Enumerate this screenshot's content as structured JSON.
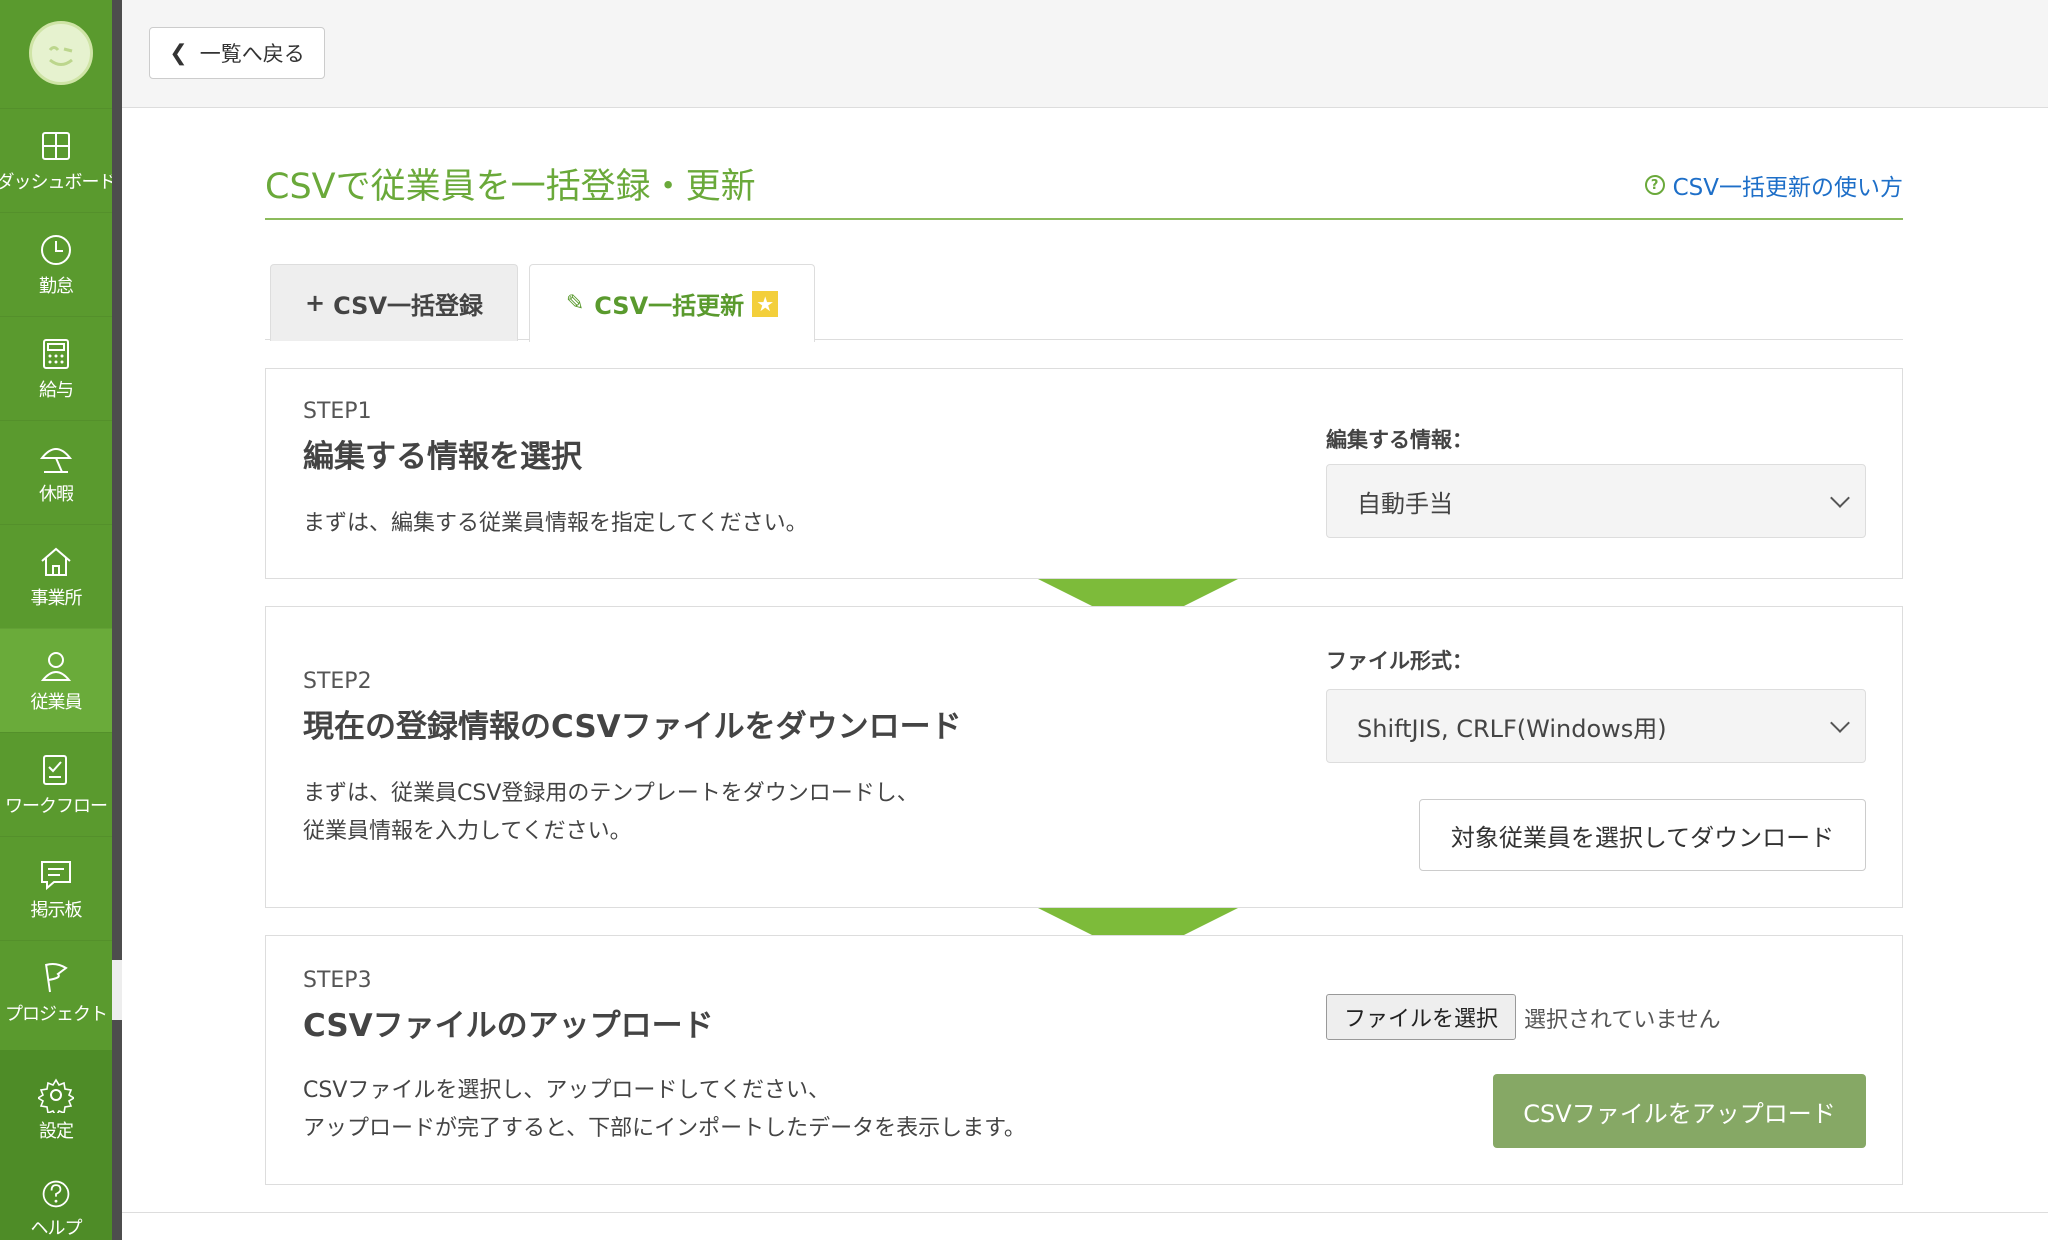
{
  "sidebar": {
    "items": [
      {
        "label": "ダッシュボード",
        "icon": "dashboard-icon"
      },
      {
        "label": "勤怠",
        "icon": "clock-icon"
      },
      {
        "label": "給与",
        "icon": "calculator-icon"
      },
      {
        "label": "休暇",
        "icon": "beach-umbrella-icon"
      },
      {
        "label": "事業所",
        "icon": "house-icon"
      },
      {
        "label": "従業員",
        "icon": "person-icon",
        "active": true
      },
      {
        "label": "ワークフロー",
        "icon": "checklist-icon"
      },
      {
        "label": "掲示板",
        "icon": "message-icon"
      },
      {
        "label": "プロジェクト",
        "icon": "flag-icon"
      },
      {
        "label": "設定",
        "icon": "gear-icon"
      },
      {
        "label": "ヘルプ",
        "icon": "help-icon"
      }
    ]
  },
  "topbar": {
    "back_label": "一覧へ戻る"
  },
  "page": {
    "title": "CSVで従業員を一括登録・更新",
    "help_link": "CSV一括更新の使い方"
  },
  "tabs": [
    {
      "label": "CSV一括登録",
      "icon": "plus-icon"
    },
    {
      "label": "CSV一括更新",
      "icon": "edit-icon",
      "active": true,
      "badge": "★"
    }
  ],
  "step1": {
    "num": "STEP1",
    "title": "編集する情報を選択",
    "desc": "まずは、編集する従業員情報を指定してください。",
    "field_label": "編集する情報：",
    "select_value": "自動手当"
  },
  "step2": {
    "num": "STEP2",
    "title": "現在の登録情報のCSVファイルをダウンロード",
    "desc_line1": "まずは、従業員CSV登録用のテンプレートをダウンロードし、",
    "desc_line2": "従業員情報を入力してください。",
    "field_label": "ファイル形式：",
    "select_value": "ShiftJIS, CRLF(Windows用)",
    "download_button": "対象従業員を選択してダウンロード"
  },
  "step3": {
    "num": "STEP3",
    "title": "CSVファイルのアップロード",
    "desc_line1": "CSVファイルを選択し、アップロードしてください、",
    "desc_line2": "アップロードが完了すると、下部にインポートしたデータを表示します。",
    "file_button": "ファイルを選択",
    "file_status": "選択されていません",
    "upload_button": "CSVファイルをアップロード"
  },
  "colors": {
    "sidebar": "#5a9a2e",
    "accent": "#6aa93a",
    "arrow": "#7dbb3a",
    "link": "#1e6fc8",
    "upload_button": "#86a865"
  }
}
